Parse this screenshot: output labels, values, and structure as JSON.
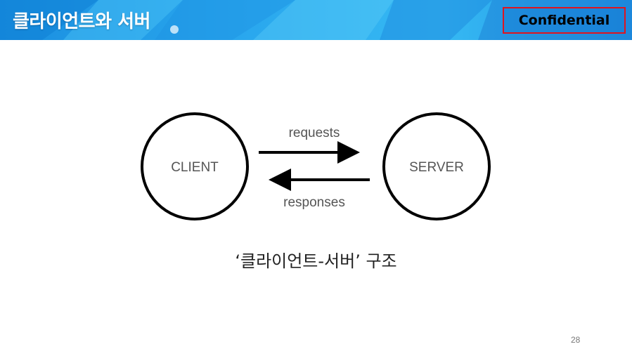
{
  "header": {
    "title": "클라이언트와 서버",
    "badge": "Confidential"
  },
  "diagram": {
    "client_label": "CLIENT",
    "server_label": "SERVER",
    "request_label": "requests",
    "response_label": "responses"
  },
  "caption": "‘클라이언트-서버’ 구조",
  "page_number": "28",
  "colors": {
    "header_blue": "#1a8fe0",
    "badge_border": "#e0141e",
    "stroke": "#000000",
    "label_gray": "#555555"
  }
}
